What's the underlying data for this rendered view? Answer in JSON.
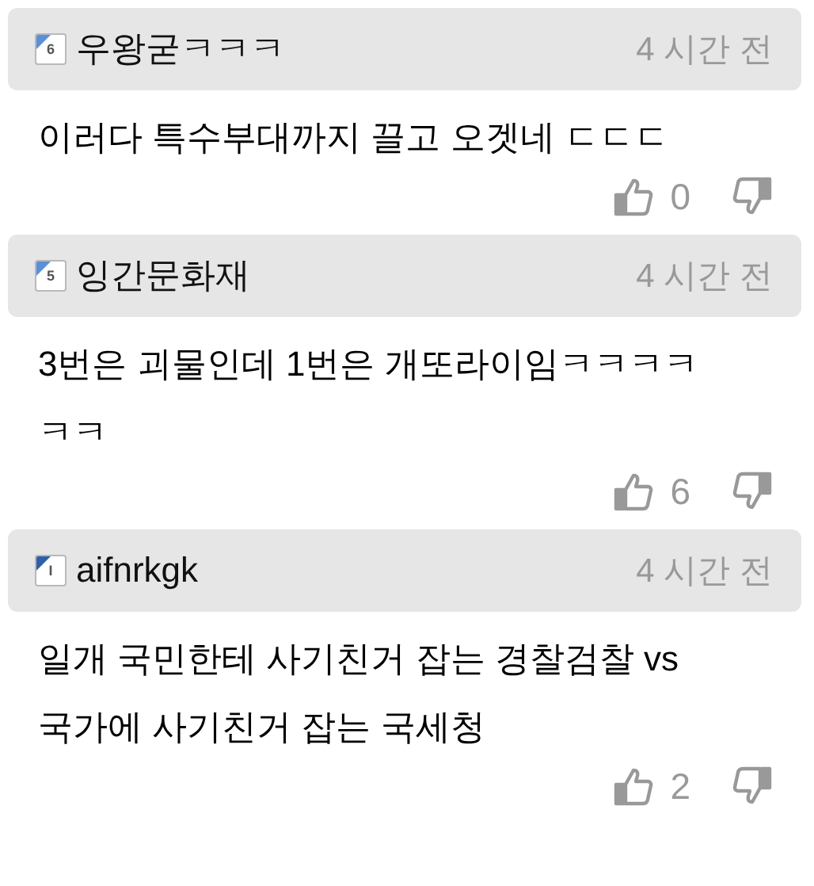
{
  "comments": [
    {
      "level": "6",
      "color": "#5b8fd9",
      "author": "우왕굳ㅋㅋㅋ",
      "time": "4 시간 전",
      "text": "이러다 특수부대까지 끌고 오겟네 ㄷㄷㄷ",
      "likes": "0"
    },
    {
      "level": "5",
      "color": "#5b8fd9",
      "author": "잉간문화재",
      "time": "4 시간 전",
      "text": "3번은 괴물인데 1번은 개또라이임ㅋㅋㅋㅋㅋㅋ",
      "likes": "6"
    },
    {
      "level": "I",
      "color": "#2f5fa8",
      "author": "aifnrkgk",
      "time": "4 시간 전",
      "text": "일개 국민한테 사기친거 잡는 경찰검찰 vs 국가에 사기친거 잡는 국세청",
      "likes": "2"
    }
  ]
}
